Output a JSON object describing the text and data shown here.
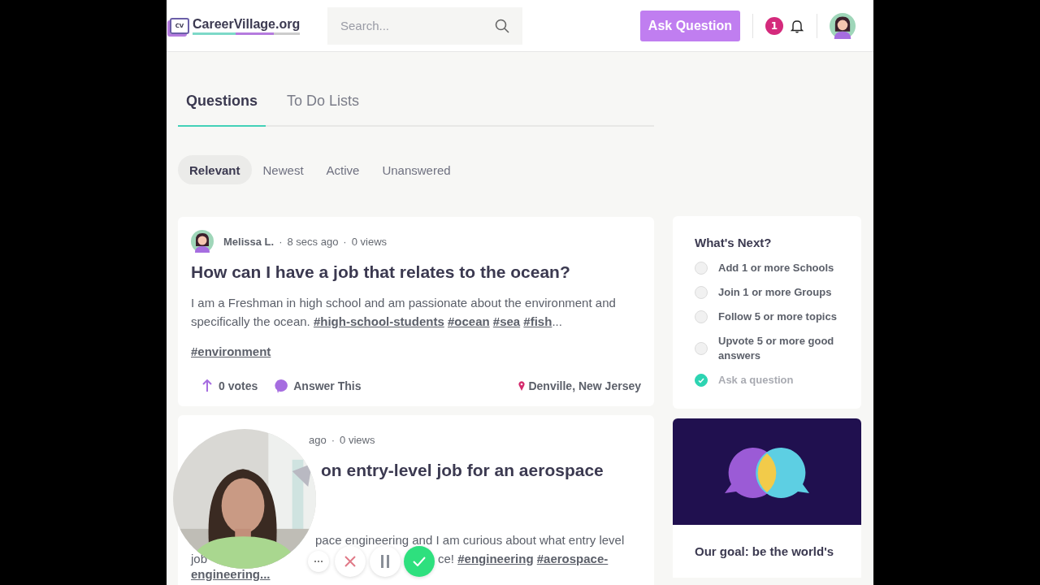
{
  "header": {
    "logo_mark": "CV",
    "logo_text": "CareerVillage.org",
    "search": {
      "placeholder": "Search..."
    },
    "ask_button": "Ask Question",
    "notification_count": "1"
  },
  "tabs": [
    {
      "label": "Questions",
      "selected": true
    },
    {
      "label": "To Do Lists",
      "selected": false
    }
  ],
  "filters": [
    {
      "label": "Relevant",
      "selected": true
    },
    {
      "label": "Newest",
      "selected": false
    },
    {
      "label": "Active",
      "selected": false
    },
    {
      "label": "Unanswered",
      "selected": false
    }
  ],
  "question": {
    "author": "Melissa L.",
    "separator": "·",
    "time": "8 secs ago",
    "views": "0 views",
    "title": "How can I have a job that relates to the ocean?",
    "body": "I am a Freshman in high school and am passionate about the environment and specifically the ocean.",
    "tags": [
      "#high-school-students",
      "#ocean",
      "#sea",
      "#fish"
    ],
    "ellipsis": "...",
    "extra_tags": [
      "#environment"
    ],
    "votes": "0 votes",
    "answer_label": "Answer This",
    "location": "Denville, New Jersey"
  },
  "partial_question": {
    "time_fragment": "ago",
    "separator": "·",
    "views": "0 views",
    "title_fragment": "on entry-level job for an aerospace",
    "body_line": "pace engineering and I am curious about what entry level",
    "line_start": "job",
    "line_fragment": "ce!",
    "tags": [
      "#engineering",
      "#aerospace-"
    ],
    "tag_continuation": "engineering..."
  },
  "whats_next": {
    "title": "What's Next?",
    "items": [
      {
        "label": "Add 1 or more Schools",
        "checked": false
      },
      {
        "label": "Join 1 or more Groups",
        "checked": false
      },
      {
        "label": "Follow 5 or more topics",
        "checked": false
      },
      {
        "label": "Upvote 5 or more good answers",
        "checked": false
      },
      {
        "label": "Ask a question",
        "checked": true
      }
    ]
  },
  "goal": {
    "text": "Our goal: be the world's"
  }
}
